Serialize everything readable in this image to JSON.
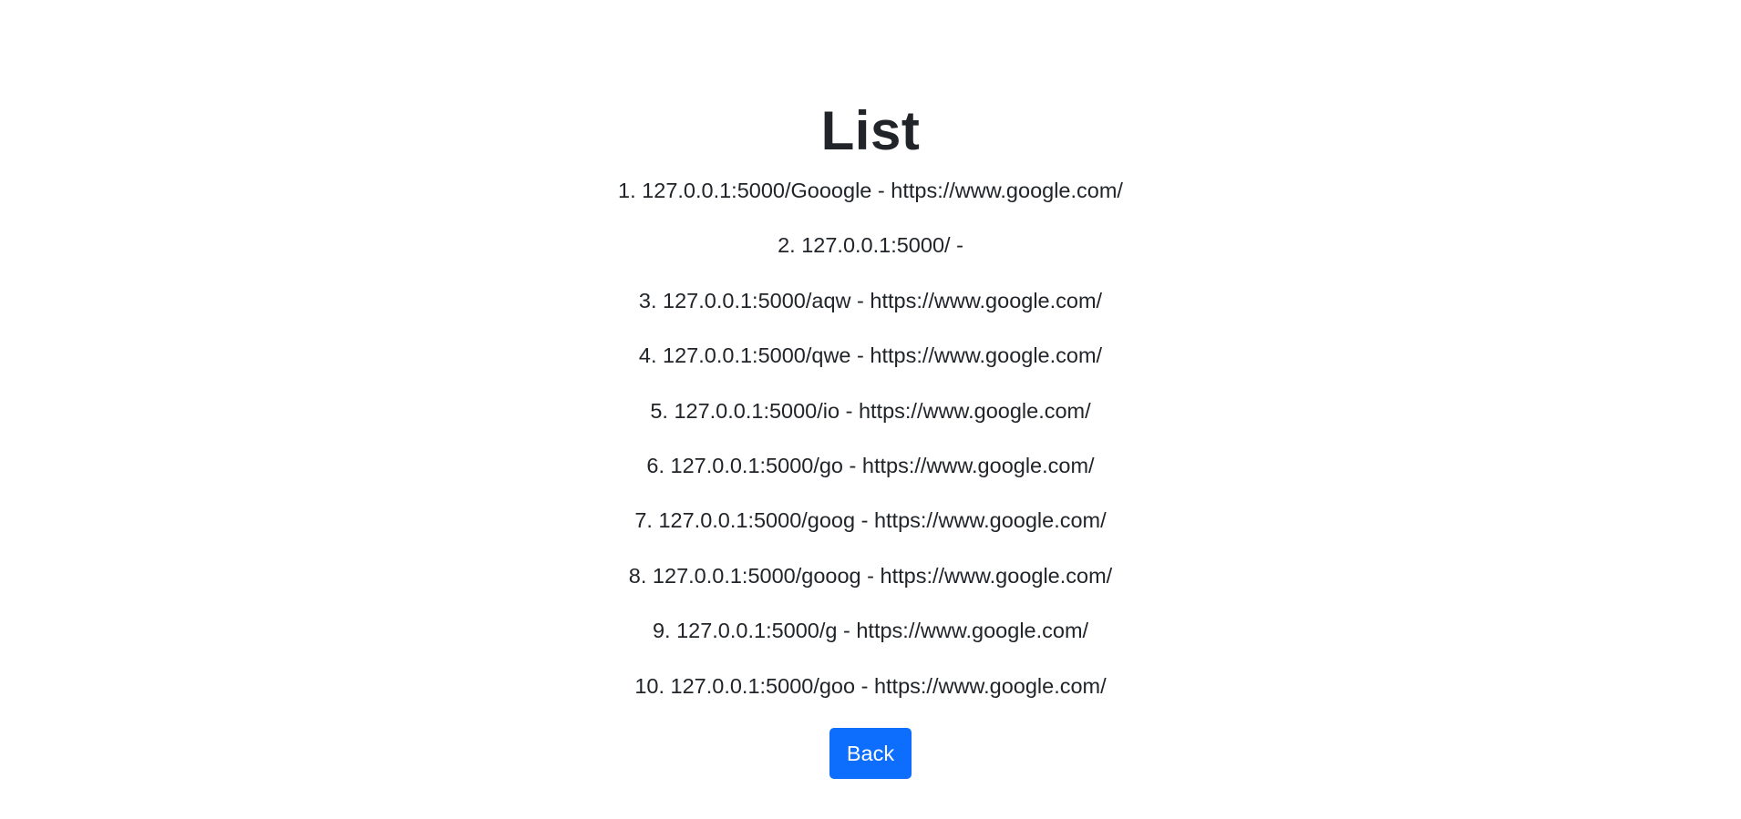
{
  "title": "List",
  "items": [
    "1. 127.0.0.1:5000/Gooogle - https://www.google.com/",
    "2. 127.0.0.1:5000/ -",
    "3. 127.0.0.1:5000/aqw - https://www.google.com/",
    "4. 127.0.0.1:5000/qwe - https://www.google.com/",
    "5. 127.0.0.1:5000/io - https://www.google.com/",
    "6. 127.0.0.1:5000/go - https://www.google.com/",
    "7. 127.0.0.1:5000/goog - https://www.google.com/",
    "8. 127.0.0.1:5000/gooog - https://www.google.com/",
    "9. 127.0.0.1:5000/g - https://www.google.com/",
    "10. 127.0.0.1:5000/goo - https://www.google.com/"
  ],
  "back_button": {
    "label": "Back",
    "color": "#0d6efd"
  }
}
